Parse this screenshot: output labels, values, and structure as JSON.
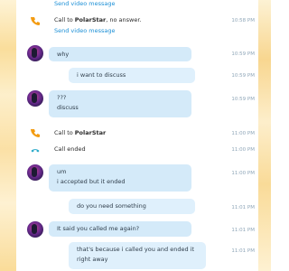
{
  "messages": {
    "top_link": "Send video message",
    "call1_text": "Call to ",
    "call1_name": "PolarStar",
    "call1_suffix": ", no answer.",
    "call1_time": "10:58 PM",
    "call1_link": "Send video message",
    "m1_text": "why",
    "m1_time": "10:59 PM",
    "m2_text": "i want to discuss",
    "m2_time": "10:59 PM",
    "m3_line1": "???",
    "m3_line2": "discuss",
    "m3_time": "10:59 PM",
    "call2_text": "Call to ",
    "call2_name": "PolarStar",
    "call2_time": "11:00 PM",
    "ended_text": "Call ended",
    "ended_time": "11:00 PM",
    "m4_line1": "um",
    "m4_line2": "i accepted but it ended",
    "m4_time": "11:00 PM",
    "m5_text": "do you need something",
    "m5_time": "11:01 PM",
    "m6_text": "It said you called me again?",
    "m6_time": "11:01 PM",
    "m7_line1": "that's because i called you and ended it",
    "m7_line2": "right away",
    "m7_time": "11:01 PM"
  },
  "colors": {
    "incoming_bubble": "#d4eaf9",
    "outgoing_bubble": "#dff0fc",
    "link": "#1b8fd6",
    "call_icon": "#f39c12",
    "ended_icon": "#27a9c9",
    "timestamp": "#8fa6b8"
  },
  "icons": {
    "call_icon": "phone-icon",
    "ended_icon": "call-ended-icon"
  }
}
